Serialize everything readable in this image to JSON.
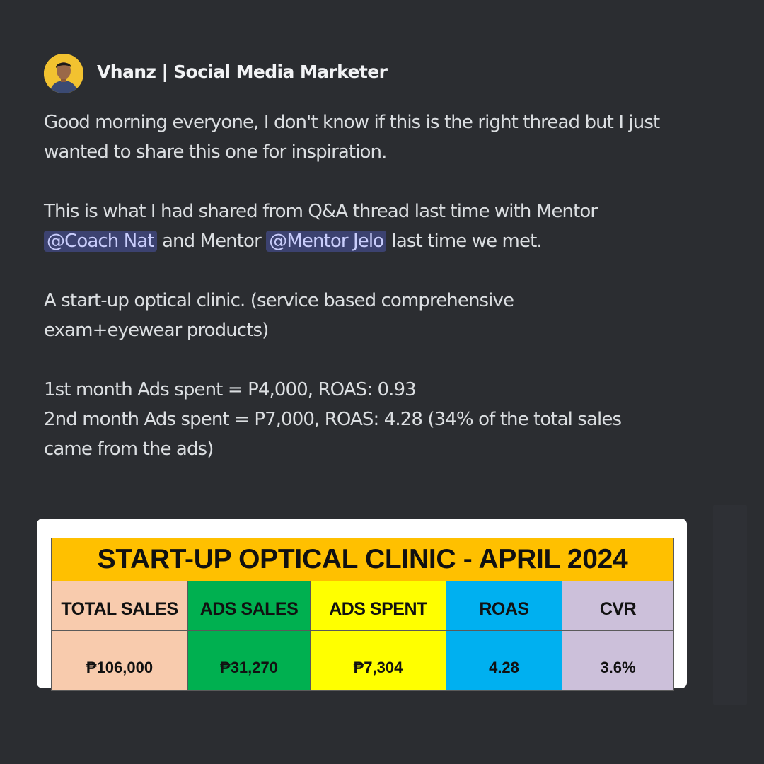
{
  "message": {
    "author": "Vhanz | Social Media Marketer",
    "paragraphs": {
      "p1": "Good morning everyone, I don't know if this is the right thread but I just wanted to share this one for inspiration.",
      "p2_before": "This is what I had shared from Q&A thread last time with Mentor ",
      "mention1": "@Coach Nat",
      "p2_middle": " and Mentor ",
      "mention2": "@Mentor Jelo",
      "p2_after": " last time we met.",
      "p3_line1": "A start-up optical clinic. (service based comprehensive",
      "p3_line2": "exam+eyewear products)",
      "p4_line1": "1st month Ads spent = P4,000, ROAS: 0.93",
      "p4_line2": "2nd month Ads spent = P7,000, ROAS: 4.28 (34% of the total sales",
      "p4_line3": "came from the ads)"
    }
  },
  "attachment": {
    "title": "START-UP OPTICAL CLINIC - APRIL 2024",
    "headers": [
      "TOTAL SALES",
      "ADS SALES",
      "ADS SPENT",
      "ROAS",
      "CVR"
    ],
    "values": [
      "₱106,000",
      "₱31,270",
      "₱7,304",
      "4.28",
      "3.6%"
    ],
    "colors": {
      "title": "#ffc000",
      "total_sales": "#f8cbad",
      "ads_sales": "#00b050",
      "ads_spent": "#ffff00",
      "roas": "#00b0f0",
      "cvr": "#ccc0da"
    }
  },
  "theme": {
    "background": "#2b2d31",
    "mention_bg": "#3c4270",
    "mention_text": "#c9cdfb"
  }
}
